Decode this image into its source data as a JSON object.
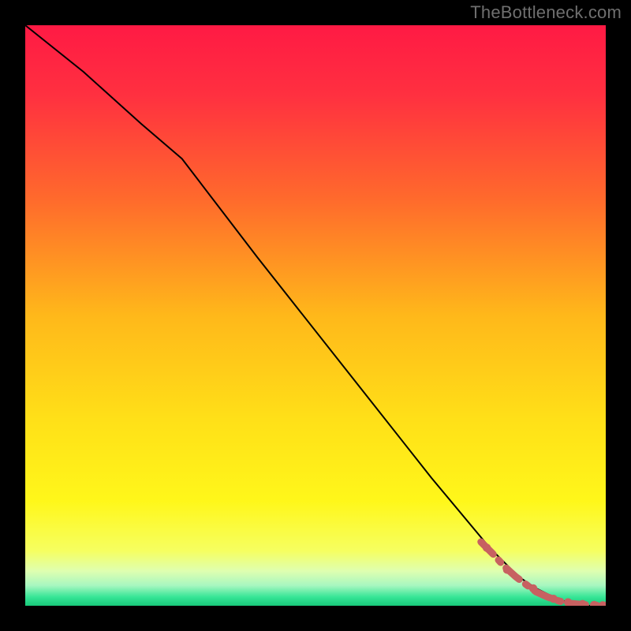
{
  "watermark": "TheBottleneck.com",
  "accent_color": "#c76161",
  "line_color": "#000000",
  "gradient_stops": [
    {
      "offset": 0.0,
      "color": "#ff1a44"
    },
    {
      "offset": 0.12,
      "color": "#ff3040"
    },
    {
      "offset": 0.3,
      "color": "#ff6a2c"
    },
    {
      "offset": 0.5,
      "color": "#ffb81a"
    },
    {
      "offset": 0.68,
      "color": "#ffe018"
    },
    {
      "offset": 0.82,
      "color": "#fff71a"
    },
    {
      "offset": 0.905,
      "color": "#f6ff60"
    },
    {
      "offset": 0.94,
      "color": "#dfffb0"
    },
    {
      "offset": 0.965,
      "color": "#a8f7c0"
    },
    {
      "offset": 0.985,
      "color": "#36e596"
    },
    {
      "offset": 1.0,
      "color": "#18c97a"
    }
  ],
  "chart_data": {
    "type": "line",
    "title": "",
    "xlabel": "",
    "ylabel": "",
    "xlim": [
      0,
      100
    ],
    "ylim": [
      0,
      100
    ],
    "legend": false,
    "grid": false,
    "series": [
      {
        "name": "curve",
        "style": "solid",
        "color_key": "line_color",
        "x": [
          0,
          10,
          20,
          27,
          40,
          55,
          70,
          80,
          85,
          88,
          92,
          96,
          100
        ],
        "y": [
          100,
          92,
          83,
          77,
          60,
          41,
          22,
          10,
          5,
          3,
          1,
          0,
          0
        ]
      },
      {
        "name": "highlight-tail",
        "style": "dash-dot",
        "color_key": "accent_color",
        "x": [
          78.5,
          80.5,
          82.5,
          84.5,
          86.5,
          88.0,
          90.0,
          92.0,
          94.0,
          96.0,
          98.0,
          100.0
        ],
        "y": [
          11.0,
          9.0,
          6.8,
          5.0,
          3.5,
          2.4,
          1.5,
          0.8,
          0.4,
          0.2,
          0.1,
          0.05
        ]
      }
    ],
    "scatter_points": {
      "name": "tail-markers",
      "color_key": "accent_color",
      "x": [
        79.5,
        83.0,
        87.5,
        91.0,
        93.5,
        96.0,
        98.0,
        99.5
      ],
      "y": [
        10.0,
        6.2,
        3.0,
        1.2,
        0.6,
        0.3,
        0.15,
        0.08
      ]
    }
  }
}
